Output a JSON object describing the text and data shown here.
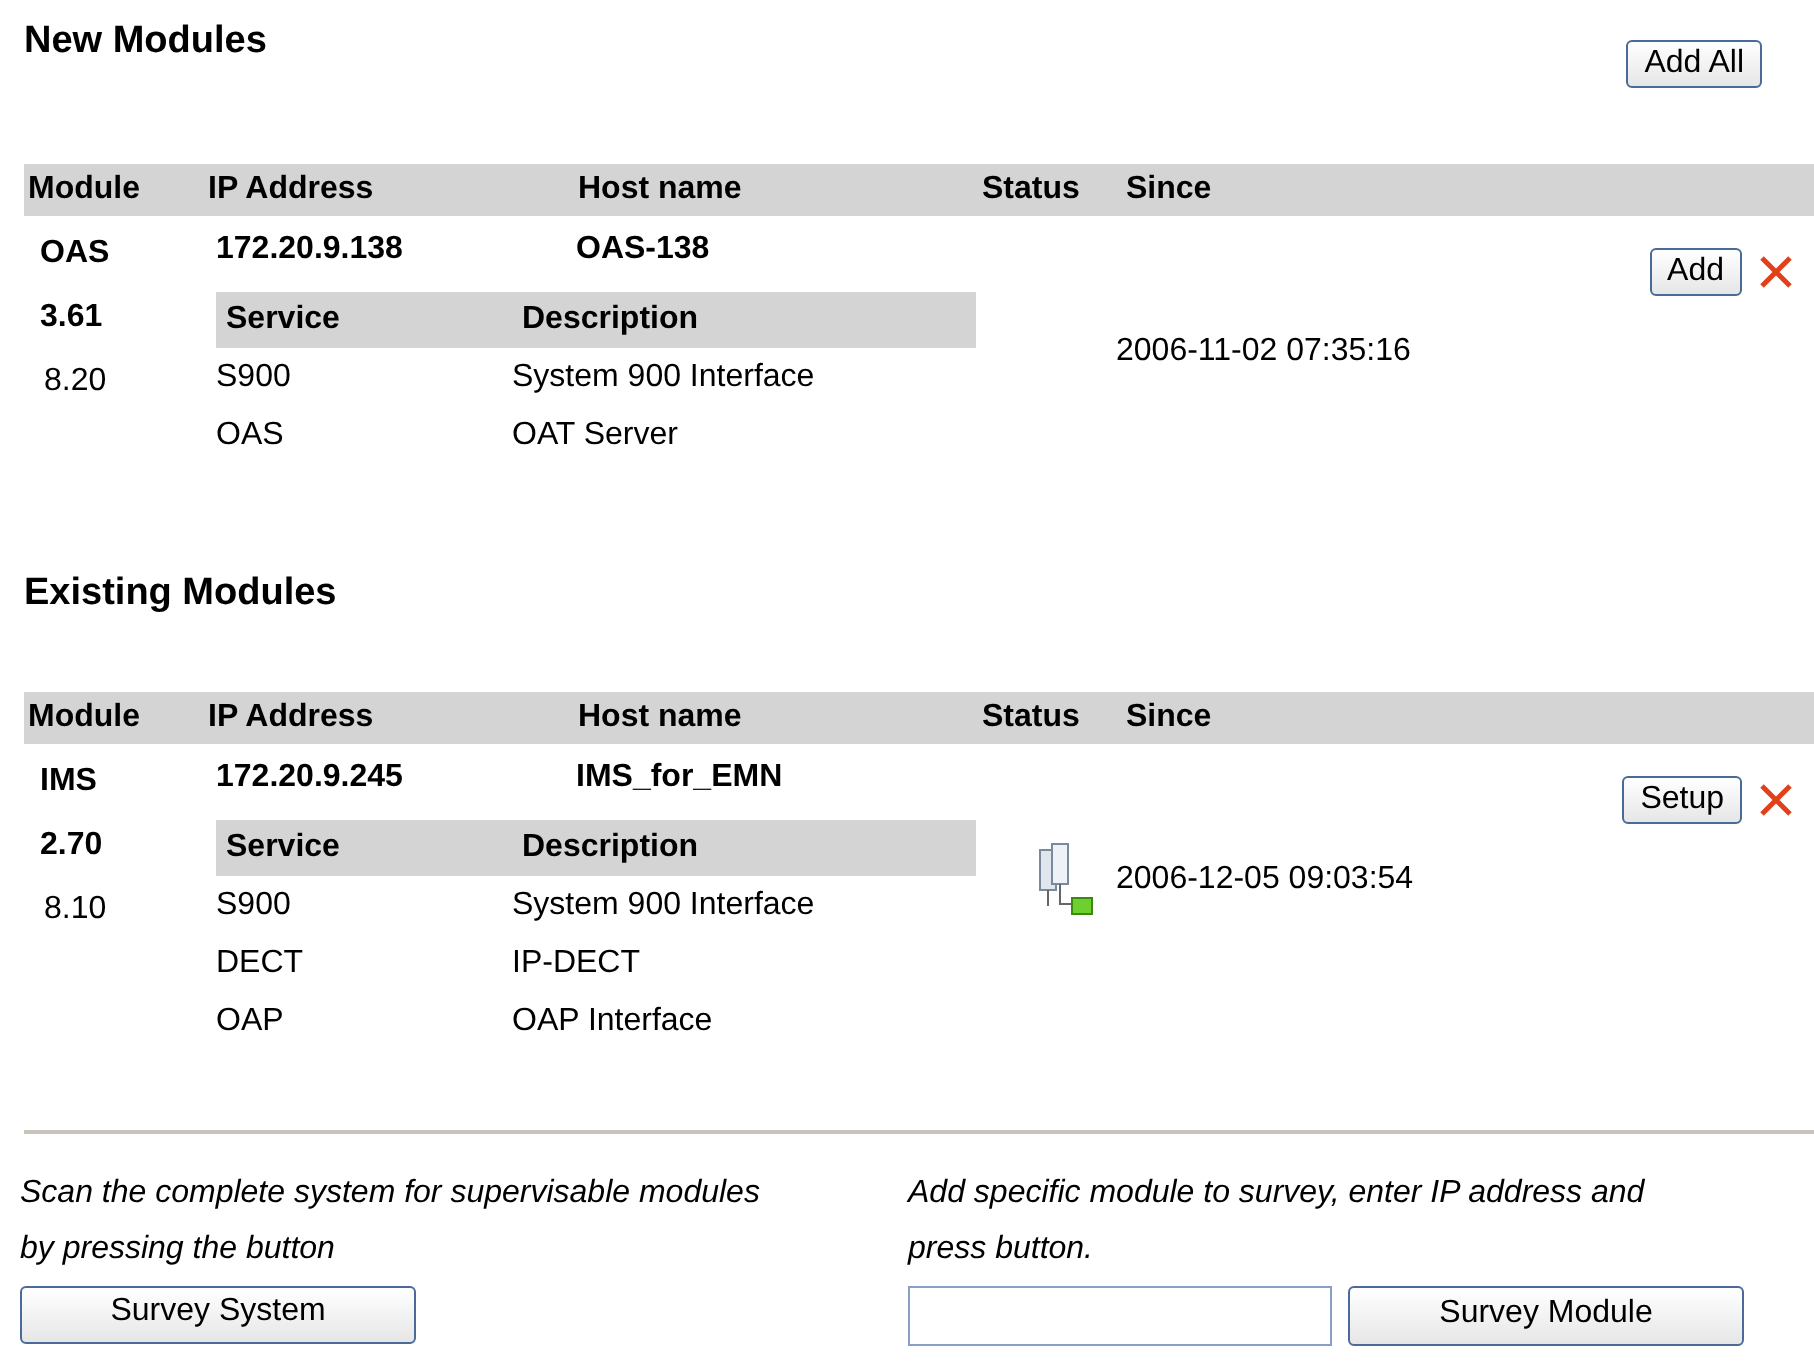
{
  "sections": [
    {
      "title": "New Modules",
      "button": "Add All",
      "columns": [
        "Module",
        "IP Address",
        "Host name",
        "Status",
        "Since"
      ],
      "modules": [
        {
          "name": "OAS",
          "version": "3.61",
          "build": "8.20",
          "ip": "172.20.9.138",
          "host": "OAS-138",
          "online": false,
          "since": "2006-11-02 07:35:16",
          "action": "Add",
          "service_columns": [
            "Service",
            "Description"
          ],
          "services": [
            {
              "service": "S900",
              "description": "System 900 Interface"
            },
            {
              "service": "OAS",
              "description": "OAT Server"
            }
          ]
        }
      ]
    },
    {
      "title": "Existing Modules",
      "columns": [
        "Module",
        "IP Address",
        "Host name",
        "Status",
        "Since"
      ],
      "modules": [
        {
          "name": "IMS",
          "version": "2.70",
          "build": "8.10",
          "ip": "172.20.9.245",
          "host": "IMS_for_EMN",
          "online": true,
          "since": "2006-12-05 09:03:54",
          "action": "Setup",
          "service_columns": [
            "Service",
            "Description"
          ],
          "services": [
            {
              "service": "S900",
              "description": "System 900 Interface"
            },
            {
              "service": "DECT",
              "description": "IP-DECT"
            },
            {
              "service": "OAP",
              "description": "OAP Interface"
            }
          ]
        }
      ]
    }
  ],
  "footer": {
    "scan_text": "Scan the complete system for supervisable modules by pressing the button",
    "scan_button": "Survey System",
    "add_text": "Add specific module to survey, enter IP address and press button.",
    "add_button": "Survey Module"
  }
}
